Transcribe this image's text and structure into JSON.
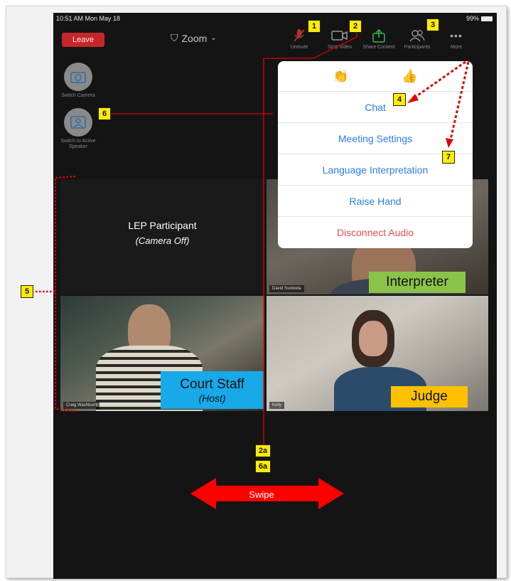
{
  "status_bar": {
    "time": "10:51 AM   Mon May 18",
    "battery": "99%"
  },
  "header": {
    "leave_label": "Leave",
    "meeting_title": "Zoom"
  },
  "toolbar": [
    {
      "label": "Unmute",
      "icon": "microphone-muted-icon"
    },
    {
      "label": "Stop Video",
      "icon": "video-camera-icon"
    },
    {
      "label": "Share Content",
      "icon": "share-arrow-icon"
    },
    {
      "label": "Participants",
      "icon": "participants-icon"
    },
    {
      "label": "More",
      "icon": "more-dots-icon"
    }
  ],
  "side_controls": [
    {
      "label": "Switch Camera",
      "icon": "switch-camera-icon"
    },
    {
      "label": "Switch to Active Speaker",
      "icon": "active-speaker-icon"
    }
  ],
  "tiles": {
    "lep": {
      "title": "LEP Participant",
      "subtitle": "(Camera Off)"
    },
    "interpreter": {
      "name_tag": "David Svoboda",
      "label": "Interpreter",
      "label_color": "#8bc34a"
    },
    "court_staff": {
      "name_tag": "Craig Washburn",
      "label": "Court Staff",
      "sublabel": "(Host)",
      "label_color": "#17a9e8"
    },
    "judge": {
      "name_tag": "Kelly",
      "label": "Judge",
      "label_color": "#ffc000"
    }
  },
  "more_menu": {
    "reactions": [
      "👏",
      "👍"
    ],
    "items": [
      "Chat",
      "Meeting Settings",
      "Language Interpretation",
      "Raise Hand",
      "Disconnect Audio"
    ]
  },
  "callouts": {
    "c1": "1",
    "c2": "2",
    "c3": "3",
    "c4": "4",
    "c5": "5",
    "c6": "6",
    "c7": "7",
    "c2a": "2a",
    "c6a": "6a"
  },
  "swipe_label": "Swipe",
  "colors": {
    "accent_blue": "#2b7ce9",
    "leave_red": "#c6262b",
    "danger_red": "#e0524b",
    "annotation_red": "#ff0000",
    "callout_yellow": "#ffec00"
  }
}
